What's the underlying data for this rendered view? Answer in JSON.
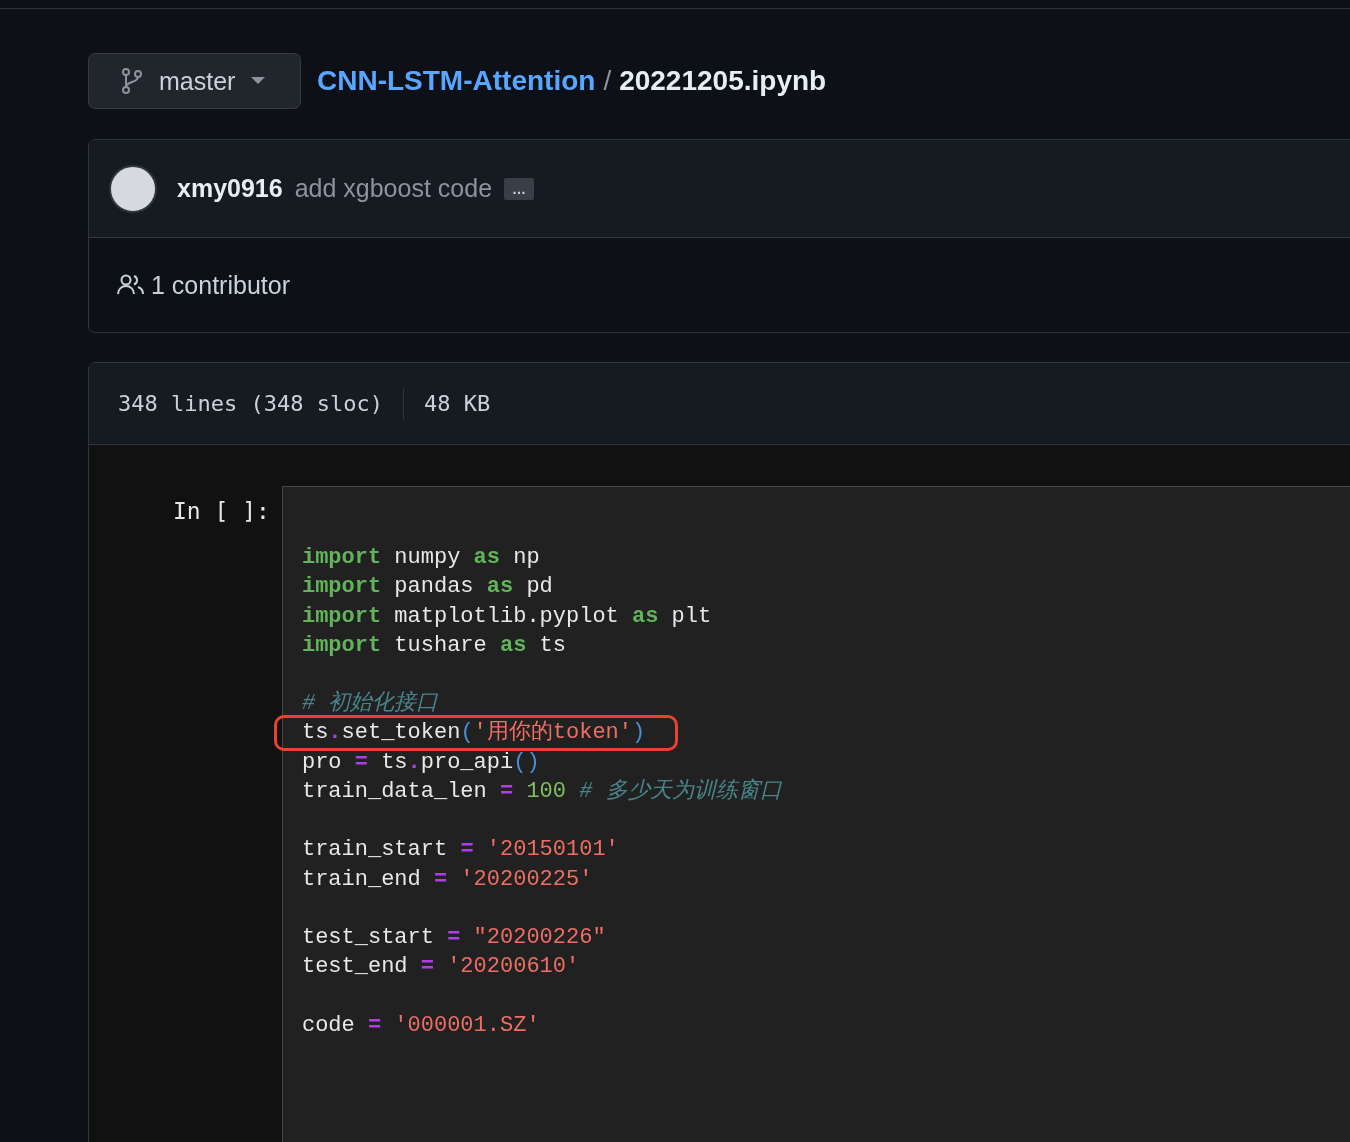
{
  "branch": {
    "name": "master"
  },
  "breadcrumb": {
    "repo": "CNN-LSTM-Attention",
    "separator": "/",
    "file": "20221205.ipynb"
  },
  "commit": {
    "author": "xmy0916",
    "message": "add xgboost code",
    "more": "…"
  },
  "contributors": {
    "label": "1 contributor"
  },
  "file_info": {
    "lines": "348 lines (348 sloc)",
    "size": "48 KB"
  },
  "cell": {
    "prompt": "In [ ]:",
    "blocks": [
      [
        {
          "highlighted": false,
          "tokens": [
            {
              "kind": "kw",
              "t": "import"
            },
            {
              "kind": "id",
              "t": " numpy "
            },
            {
              "kind": "kw",
              "t": "as"
            },
            {
              "kind": "id",
              "t": " np"
            }
          ]
        },
        {
          "highlighted": false,
          "tokens": [
            {
              "kind": "kw",
              "t": "import"
            },
            {
              "kind": "id",
              "t": " pandas "
            },
            {
              "kind": "kw",
              "t": "as"
            },
            {
              "kind": "id",
              "t": " pd"
            }
          ]
        },
        {
          "highlighted": false,
          "tokens": [
            {
              "kind": "kw",
              "t": "import"
            },
            {
              "kind": "id",
              "t": " matplotlib.pyplot "
            },
            {
              "kind": "kw",
              "t": "as"
            },
            {
              "kind": "id",
              "t": " plt"
            }
          ]
        },
        {
          "highlighted": false,
          "tokens": [
            {
              "kind": "kw",
              "t": "import"
            },
            {
              "kind": "id",
              "t": " tushare "
            },
            {
              "kind": "kw",
              "t": "as"
            },
            {
              "kind": "id",
              "t": " ts"
            }
          ]
        }
      ],
      [
        {
          "highlighted": false,
          "tokens": [
            {
              "kind": "comment",
              "t": "# 初始化接口"
            }
          ]
        },
        {
          "highlighted": true,
          "tokens": [
            {
              "kind": "id",
              "t": "ts"
            },
            {
              "kind": "op",
              "t": "."
            },
            {
              "kind": "id",
              "t": "set_token"
            },
            {
              "kind": "paren",
              "t": "("
            },
            {
              "kind": "str",
              "t": "'用你的token'"
            },
            {
              "kind": "paren",
              "t": ")"
            }
          ]
        },
        {
          "highlighted": false,
          "tokens": [
            {
              "kind": "id",
              "t": "pro "
            },
            {
              "kind": "op",
              "t": "="
            },
            {
              "kind": "id",
              "t": " ts"
            },
            {
              "kind": "op",
              "t": "."
            },
            {
              "kind": "id",
              "t": "pro_api"
            },
            {
              "kind": "paren",
              "t": "()"
            }
          ]
        },
        {
          "highlighted": false,
          "tokens": [
            {
              "kind": "id",
              "t": "train_data_len "
            },
            {
              "kind": "op",
              "t": "="
            },
            {
              "kind": "num",
              "t": " 100 "
            },
            {
              "kind": "comment",
              "t": "# 多少天为训练窗口"
            }
          ]
        }
      ],
      [
        {
          "highlighted": false,
          "tokens": [
            {
              "kind": "id",
              "t": "train_start "
            },
            {
              "kind": "op",
              "t": "="
            },
            {
              "kind": "str",
              "t": " '20150101'"
            }
          ]
        },
        {
          "highlighted": false,
          "tokens": [
            {
              "kind": "id",
              "t": "train_end "
            },
            {
              "kind": "op",
              "t": "="
            },
            {
              "kind": "str",
              "t": " '20200225'"
            }
          ]
        }
      ],
      [
        {
          "highlighted": false,
          "tokens": [
            {
              "kind": "id",
              "t": "test_start "
            },
            {
              "kind": "op",
              "t": "="
            },
            {
              "kind": "str",
              "t": " \"20200226\""
            }
          ]
        },
        {
          "highlighted": false,
          "tokens": [
            {
              "kind": "id",
              "t": "test_end "
            },
            {
              "kind": "op",
              "t": "="
            },
            {
              "kind": "str",
              "t": " '20200610'"
            }
          ]
        }
      ],
      [
        {
          "highlighted": false,
          "tokens": [
            {
              "kind": "id",
              "t": "code "
            },
            {
              "kind": "op",
              "t": "="
            },
            {
              "kind": "str",
              "t": " '000001.SZ'"
            }
          ]
        }
      ]
    ]
  }
}
